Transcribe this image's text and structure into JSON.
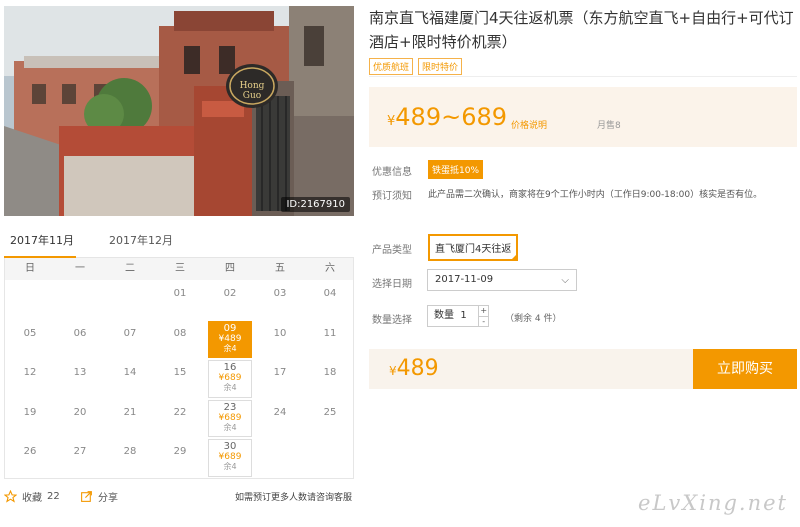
{
  "product": {
    "title": "南京直飞福建厦门4天往返机票（东方航空直飞+自由行+可代订酒店+限时特价机票）",
    "tags": [
      "优质航班",
      "限时特价"
    ],
    "photo_id": "ID:2167910",
    "sign_text": "Hong Guo"
  },
  "pricing": {
    "currency": "¥",
    "range": "489~689",
    "price_note": "价格说明",
    "monthly_sales": "月售8"
  },
  "info": {
    "discount_label": "优惠信息",
    "discount_badge": "铁蛋抵10%",
    "notice_label": "预订须知",
    "notice_text": "此产品需二次确认，商家将在9个工作小时内（工作日9:00-18:00）核实是否有位。"
  },
  "options": {
    "type_label": "产品类型",
    "type_value": "直飞厦门4天往返",
    "date_label": "选择日期",
    "date_value": "2017-11-09",
    "qty_label": "数量选择",
    "qty_text": "数量",
    "qty_value": "1",
    "qty_plus": "+",
    "qty_minus": "-",
    "stock": "（剩余 4 件）"
  },
  "buy": {
    "total": "489",
    "button": "立即购买"
  },
  "calendar": {
    "months": [
      "2017年11月",
      "2017年12月"
    ],
    "weekdays": [
      "日",
      "一",
      "二",
      "三",
      "四",
      "五",
      "六"
    ],
    "cells": [
      {
        "day": ""
      },
      {
        "day": ""
      },
      {
        "day": ""
      },
      {
        "day": "01"
      },
      {
        "day": "02"
      },
      {
        "day": "03"
      },
      {
        "day": "04"
      },
      {
        "day": "05"
      },
      {
        "day": "06"
      },
      {
        "day": "07"
      },
      {
        "day": "08"
      },
      {
        "day": "09",
        "price": "¥489",
        "remain": "余4",
        "selected": true
      },
      {
        "day": "10"
      },
      {
        "day": "11"
      },
      {
        "day": "12"
      },
      {
        "day": "13"
      },
      {
        "day": "14"
      },
      {
        "day": "15"
      },
      {
        "day": "16",
        "price": "¥689",
        "remain": "余4"
      },
      {
        "day": "17"
      },
      {
        "day": "18"
      },
      {
        "day": "19"
      },
      {
        "day": "20"
      },
      {
        "day": "21"
      },
      {
        "day": "22"
      },
      {
        "day": "23",
        "price": "¥689",
        "remain": "余4"
      },
      {
        "day": "24"
      },
      {
        "day": "25"
      },
      {
        "day": "26"
      },
      {
        "day": "27"
      },
      {
        "day": "28"
      },
      {
        "day": "29"
      },
      {
        "day": "30",
        "price": "¥689",
        "remain": "余4"
      },
      {
        "day": ""
      },
      {
        "day": ""
      }
    ]
  },
  "social": {
    "favorites_label": "收藏",
    "favorites_count": "22",
    "share_label": "分享",
    "consult": "如需预订更多人数请咨询客服"
  },
  "watermark": "eLvXing.net",
  "colors": {
    "accent": "#f39800",
    "panel_bg": "#fbf3ea"
  }
}
